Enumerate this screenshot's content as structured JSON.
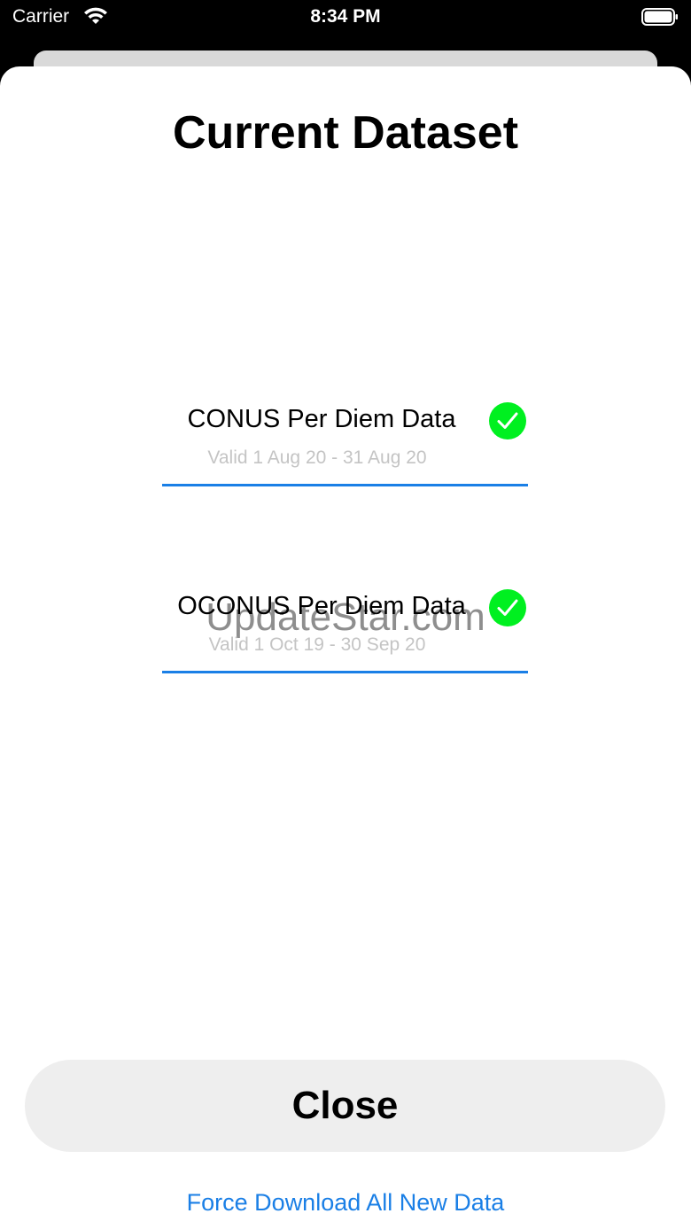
{
  "status_bar": {
    "carrier": "Carrier",
    "time": "8:34 PM",
    "wifi_icon": "wifi-icon",
    "battery_icon": "battery-full-icon"
  },
  "title": "Current Dataset",
  "datasets": [
    {
      "label": "CONUS Per Diem Data",
      "validity": "Valid 1 Aug 20 - 31 Aug 20",
      "status_icon": "checkmark-circle-icon"
    },
    {
      "label": "OCONUS Per Diem Data",
      "validity": "Valid 1 Oct 19 - 30 Sep 20",
      "status_icon": "checkmark-circle-icon"
    }
  ],
  "watermark": "UpdateStar.com",
  "actions": {
    "close_label": "Close",
    "force_download_label": "Force Download All New Data"
  },
  "colors": {
    "accent": "#1a7fe6",
    "check": "#00f020",
    "button_bg": "#eeeeee",
    "subtitle": "#c4c4c4"
  }
}
